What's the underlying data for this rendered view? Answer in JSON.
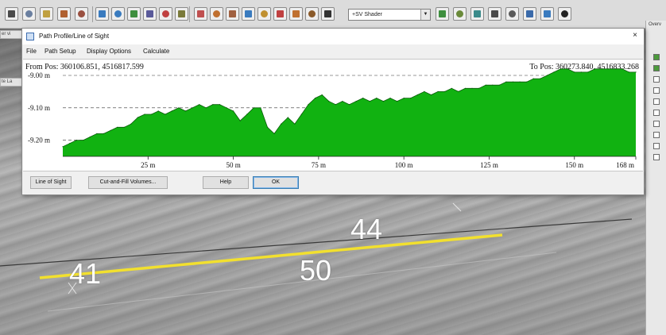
{
  "toolbar": {
    "shader_label": "+SV Shader",
    "left_buttons": [
      {
        "icon": "save-icon",
        "color": "#4a4a4a"
      },
      {
        "icon": "grid-icon",
        "color": "#6a7fa0"
      },
      {
        "icon": "layer-icon",
        "color": "#c0a040"
      },
      {
        "icon": "table-icon",
        "color": "#b06030"
      },
      {
        "icon": "tools-icon",
        "color": "#9a5040"
      }
    ],
    "mid_buttons": [
      {
        "icon": "zoom-in-icon",
        "color": "#3a7bbf"
      },
      {
        "icon": "zoom-out-icon",
        "color": "#3a7bbf"
      },
      {
        "icon": "globe-icon",
        "color": "#3f8f3f"
      },
      {
        "icon": "pan-icon",
        "color": "#5a5a9a"
      },
      {
        "icon": "refresh-icon",
        "color": "#c04040"
      },
      {
        "icon": "map-icon",
        "color": "#7a7a3a"
      }
    ],
    "edit_buttons": [
      {
        "icon": "select-icon",
        "color": "#c05050"
      },
      {
        "icon": "measure-icon",
        "color": "#c07030"
      },
      {
        "icon": "ruler-icon",
        "color": "#a06040"
      },
      {
        "icon": "info-icon",
        "color": "#3a7bbf"
      },
      {
        "icon": "path-profile-icon",
        "color": "#c09030"
      },
      {
        "icon": "line-icon",
        "color": "#c04040"
      },
      {
        "icon": "digitize-icon",
        "color": "#c07030"
      },
      {
        "icon": "view-3d-icon",
        "color": "#8a5a2a"
      },
      {
        "icon": "binoculars-icon",
        "color": "#333333"
      }
    ],
    "right_buttons": [
      {
        "icon": "shader-icon",
        "color": "#3f8f3f"
      },
      {
        "icon": "contour-icon",
        "color": "#6a8a3a"
      },
      {
        "icon": "terrain-icon",
        "color": "#3a8a8a"
      },
      {
        "icon": "pointer-icon",
        "color": "#4a4a4a"
      },
      {
        "icon": "print-icon",
        "color": "#5a5a5a"
      },
      {
        "icon": "export-icon",
        "color": "#3a6aaa"
      },
      {
        "icon": "gps-icon",
        "color": "#3a7bbf"
      },
      {
        "icon": "north-arrow-icon",
        "color": "#222222"
      }
    ]
  },
  "dialog": {
    "title": "Path Profile/Line of Sight",
    "close_label": "×",
    "menu": [
      "File",
      "Path Setup",
      "Display Options",
      "Calculate"
    ],
    "from_pos": "From Pos: 360106.851, 4516817.599",
    "to_pos": "To Pos: 360273.840, 4516833.268",
    "buttons": {
      "line_of_sight": "Line of Sight",
      "cut_fill": "Cut-and-Fill Volumes...",
      "help": "Help",
      "ok": "OK"
    }
  },
  "chart_data": {
    "type": "area",
    "title": "",
    "xlabel": "",
    "ylabel": "",
    "xlim": [
      0,
      168
    ],
    "ylim": [
      -9.25,
      -9.0
    ],
    "grid": true,
    "x_ticks": [
      25,
      50,
      75,
      100,
      125,
      150,
      168
    ],
    "x_tick_labels": [
      "25 m",
      "50 m",
      "75 m",
      "100 m",
      "125 m",
      "150 m",
      "168 m"
    ],
    "y_ticks": [
      -9.0,
      -9.1,
      -9.2
    ],
    "y_tick_labels": [
      "-9.00 m",
      "-9.10 m",
      "-9.20 m"
    ],
    "fill_color": "#11b211",
    "line_color": "#0a5a0a",
    "x": [
      0,
      2,
      4,
      6,
      8,
      10,
      12,
      14,
      16,
      18,
      20,
      22,
      24,
      26,
      28,
      30,
      32,
      34,
      36,
      38,
      40,
      42,
      44,
      46,
      48,
      50,
      52,
      54,
      56,
      58,
      60,
      62,
      64,
      66,
      68,
      70,
      72,
      74,
      76,
      78,
      80,
      82,
      84,
      86,
      88,
      90,
      92,
      94,
      96,
      98,
      100,
      102,
      104,
      106,
      108,
      110,
      112,
      114,
      116,
      118,
      120,
      122,
      124,
      126,
      128,
      130,
      132,
      134,
      136,
      138,
      140,
      142,
      144,
      146,
      148,
      150,
      152,
      154,
      156,
      158,
      160,
      162,
      164,
      166,
      168
    ],
    "y": [
      -9.22,
      -9.21,
      -9.2,
      -9.2,
      -9.19,
      -9.18,
      -9.18,
      -9.17,
      -9.16,
      -9.16,
      -9.15,
      -9.13,
      -9.12,
      -9.12,
      -9.11,
      -9.12,
      -9.11,
      -9.1,
      -9.11,
      -9.1,
      -9.09,
      -9.1,
      -9.09,
      -9.09,
      -9.1,
      -9.11,
      -9.14,
      -9.12,
      -9.1,
      -9.1,
      -9.16,
      -9.18,
      -9.15,
      -9.13,
      -9.15,
      -9.12,
      -9.09,
      -9.07,
      -9.06,
      -9.08,
      -9.09,
      -9.08,
      -9.09,
      -9.08,
      -9.07,
      -9.08,
      -9.07,
      -9.08,
      -9.07,
      -9.08,
      -9.07,
      -9.07,
      -9.06,
      -9.05,
      -9.06,
      -9.05,
      -9.05,
      -9.04,
      -9.05,
      -9.04,
      -9.04,
      -9.04,
      -9.03,
      -9.03,
      -9.03,
      -9.02,
      -9.02,
      -9.02,
      -9.02,
      -9.01,
      -9.01,
      -9.0,
      -8.99,
      -8.98,
      -8.98,
      -8.99,
      -8.99,
      -8.99,
      -8.98,
      -8.98,
      -8.98,
      -8.98,
      -8.98,
      -8.99,
      -8.99
    ]
  },
  "map": {
    "labels": [
      "41",
      "44",
      "50"
    ],
    "profile_color": "#f2e02e"
  },
  "right_panel": {
    "header": "Overv",
    "checks": [
      true,
      true,
      false,
      false,
      false,
      false,
      false,
      false,
      false,
      false
    ]
  },
  "frame_edge": {
    "labels": [
      "er vi",
      "te La"
    ]
  }
}
